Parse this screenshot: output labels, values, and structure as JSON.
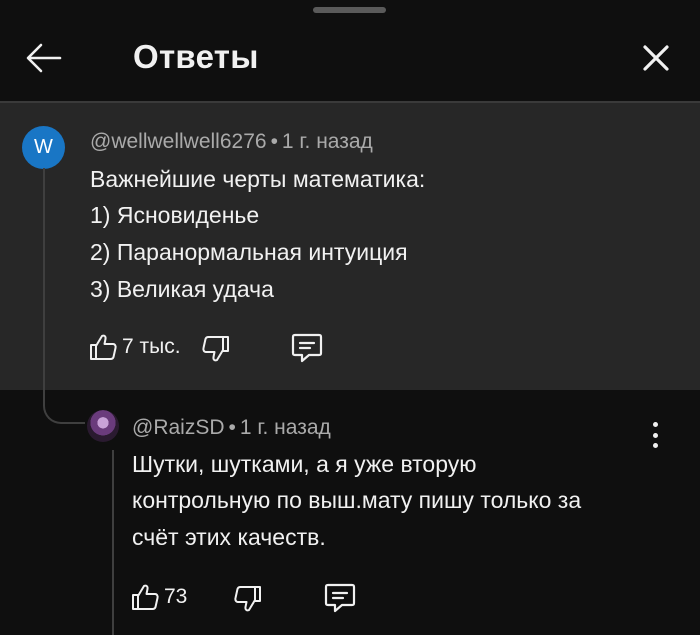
{
  "header": {
    "title": "Ответы"
  },
  "parent_comment": {
    "avatar_letter": "W",
    "avatar_color": "#1976c5",
    "author": "@wellwellwell6276",
    "separator": "•",
    "time": "1 г. назад",
    "lines": [
      "Важнейшие черты математика:",
      "1) Ясновиденье",
      "2) Паранормальная интуиция",
      "3) Великая удача"
    ],
    "likes": "7 тыс."
  },
  "reply": {
    "author": "@RaizSD",
    "separator": "•",
    "time": "1 г. назад",
    "lines": [
      "Шутки, шутками, а я уже вторую",
      "контрольную по выш.мату пишу только за",
      "счёт этих качеств."
    ],
    "likes": "73"
  }
}
